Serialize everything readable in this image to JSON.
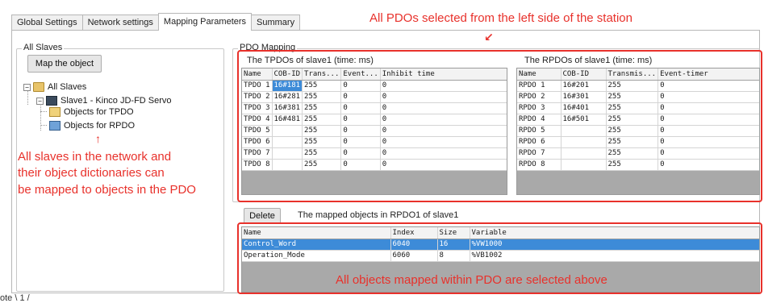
{
  "tabs": [
    "Global Settings",
    "Network settings",
    "Mapping Parameters",
    "Summary"
  ],
  "active_tab": "Mapping Parameters",
  "left_panel": {
    "title": "All Slaves",
    "map_button": "Map the object",
    "tree": {
      "root": "All Slaves",
      "slave": "Slave1 - Kinco JD-FD Servo",
      "tpdo_objects": "Objects for TPDO",
      "rpdo_objects": "Objects for RPDO"
    }
  },
  "pdo_mapping": {
    "title": "PDO Mapping",
    "tpdo": {
      "caption": "The TPDOs of slave1 (time: ms)",
      "headers": [
        "Name",
        "COB-ID",
        "Trans...",
        "Event...",
        "Inhibit time"
      ],
      "rows": [
        [
          "TPDO 1",
          "16#181",
          "255",
          "0",
          "0"
        ],
        [
          "TPDO 2",
          "16#281",
          "255",
          "0",
          "0"
        ],
        [
          "TPDO 3",
          "16#381",
          "255",
          "0",
          "0"
        ],
        [
          "TPDO 4",
          "16#481",
          "255",
          "0",
          "0"
        ],
        [
          "TPDO 5",
          "",
          "255",
          "0",
          "0"
        ],
        [
          "TPDO 6",
          "",
          "255",
          "0",
          "0"
        ],
        [
          "TPDO 7",
          "",
          "255",
          "0",
          "0"
        ],
        [
          "TPDO 8",
          "",
          "255",
          "0",
          "0"
        ]
      ]
    },
    "rpdo": {
      "caption": "The RPDOs of slave1 (time: ms)",
      "headers": [
        "Name",
        "COB-ID",
        "Transmis...",
        "Event-timer"
      ],
      "rows": [
        [
          "RPDO 1",
          "16#201",
          "255",
          "0"
        ],
        [
          "RPDO 2",
          "16#301",
          "255",
          "0"
        ],
        [
          "RPDO 3",
          "16#401",
          "255",
          "0"
        ],
        [
          "RPDO 4",
          "16#501",
          "255",
          "0"
        ],
        [
          "RPDO 5",
          "",
          "255",
          "0"
        ],
        [
          "RPDO 6",
          "",
          "255",
          "0"
        ],
        [
          "RPDO 7",
          "",
          "255",
          "0"
        ],
        [
          "RPDO 8",
          "",
          "255",
          "0"
        ]
      ]
    }
  },
  "mapped": {
    "delete_button": "Delete",
    "caption": "The mapped objects in RPDO1 of slave1",
    "headers": [
      "Name",
      "Index",
      "Size",
      "Variable"
    ],
    "rows": [
      [
        "Control_Word",
        "6040",
        "16",
        "%VW1000"
      ],
      [
        "Operation_Mode",
        "6060",
        "8",
        "%VB1002"
      ]
    ]
  },
  "annotations": {
    "top": "All PDOs selected from the left side of the station",
    "left_line1": "All slaves in the network and",
    "left_line2": "their object dictionaries can",
    "left_line3": "be mapped to objects in the PDO",
    "bottom": "All objects mapped within PDO are selected above",
    "color": "#e8312b"
  },
  "bottom_tab": "ote \\ 1 /"
}
